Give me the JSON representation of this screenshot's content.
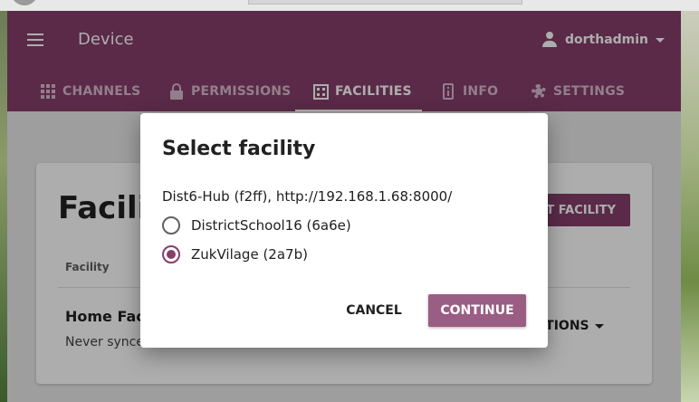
{
  "app": {
    "title": "Device",
    "user": "dorthadmin"
  },
  "tabs": [
    {
      "label": "CHANNELS",
      "icon": "grid-icon"
    },
    {
      "label": "PERMISSIONS",
      "icon": "lock-icon"
    },
    {
      "label": "FACILITIES",
      "icon": "building-icon",
      "active": true
    },
    {
      "label": "INFO",
      "icon": "info-icon"
    },
    {
      "label": "SETTINGS",
      "icon": "gear-icon"
    }
  ],
  "page": {
    "heading": "Facilities",
    "import_button": "IMPORT FACILITY",
    "column_header": "Facility",
    "row": {
      "name": "Home Facility",
      "sync_status": "Never synced",
      "options": "OPTIONS"
    }
  },
  "modal": {
    "title": "Select facility",
    "device": "Dist6-Hub (f2ff), http://192.168.1.68:8000/",
    "options": [
      {
        "label": "DistrictSchool16 (6a6e)",
        "selected": false
      },
      {
        "label": "ZukVilage (2a7b)",
        "selected": true
      }
    ],
    "cancel_label": "CANCEL",
    "continue_label": "CONTINUE"
  },
  "colors": {
    "brand": "#853f6b",
    "button_continue": "#9a5d84"
  }
}
